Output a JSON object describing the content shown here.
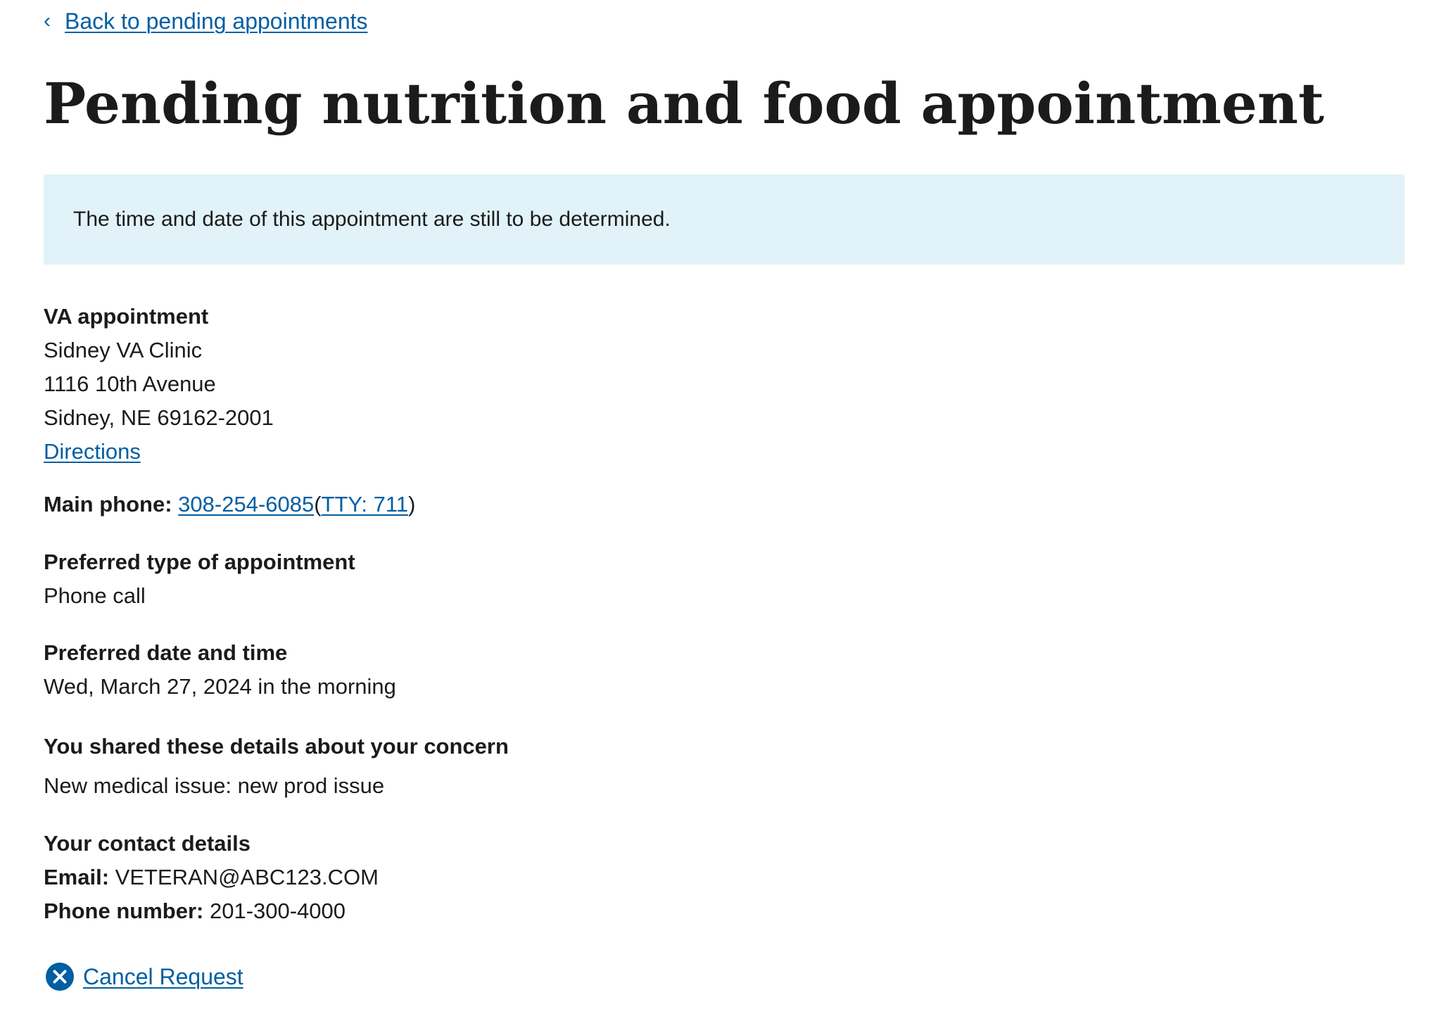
{
  "nav": {
    "back_label": "Back to pending appointments"
  },
  "header": {
    "title": "Pending nutrition and food appointment"
  },
  "alert": {
    "message": "The time and date of this appointment are still to be determined."
  },
  "location": {
    "heading": "VA appointment",
    "facility_name": "Sidney VA Clinic",
    "street": "1116 10th Avenue",
    "city_state_zip": "Sidney, NE 69162-2001",
    "directions_label": "Directions"
  },
  "phone": {
    "label": "Main phone:",
    "number": "308-254-6085",
    "open_paren": "(",
    "tty_label": "TTY: 711",
    "close_paren": ")"
  },
  "preferred_type": {
    "heading": "Preferred type of appointment",
    "value": "Phone call"
  },
  "preferred_datetime": {
    "heading": "Preferred date and time",
    "value": "Wed, March 27, 2024 in the morning"
  },
  "concern": {
    "heading": "You shared these details about your concern",
    "value": "New medical issue: new prod issue"
  },
  "contact": {
    "heading": "Your contact details",
    "email_label": "Email:",
    "email_value": "VETERAN@ABC123.COM",
    "phone_label": "Phone number:",
    "phone_value": "201-300-4000"
  },
  "actions": {
    "cancel_label": "Cancel Request"
  },
  "icons": {
    "back": "chevron-left-icon",
    "cancel": "cancel-circle-icon"
  },
  "colors": {
    "link": "#005ea2",
    "alert_background": "#e1f3f8",
    "text": "#1b1b1b"
  }
}
